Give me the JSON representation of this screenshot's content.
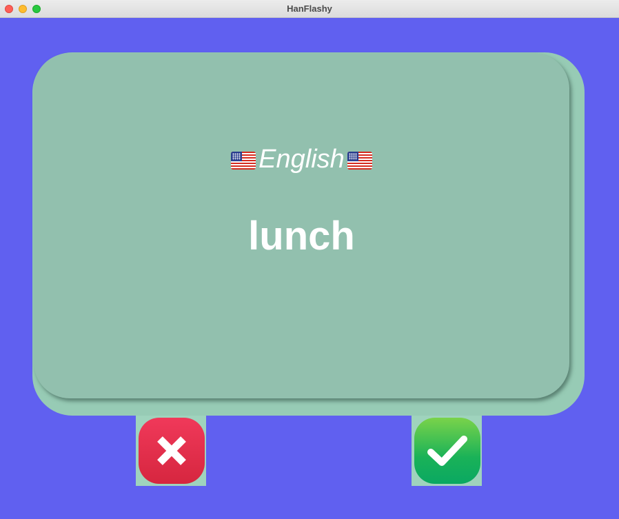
{
  "window": {
    "title": "HanFlashy"
  },
  "card": {
    "language_label": "English",
    "flag_icon": "us-flag-icon",
    "word": "lunch"
  },
  "buttons": {
    "wrong_icon": "x-mark-icon",
    "right_icon": "check-mark-icon"
  },
  "colors": {
    "background": "#6060f0",
    "card": "#92c0ae",
    "wrong": "#e3304c",
    "right": "#3dc44f"
  }
}
